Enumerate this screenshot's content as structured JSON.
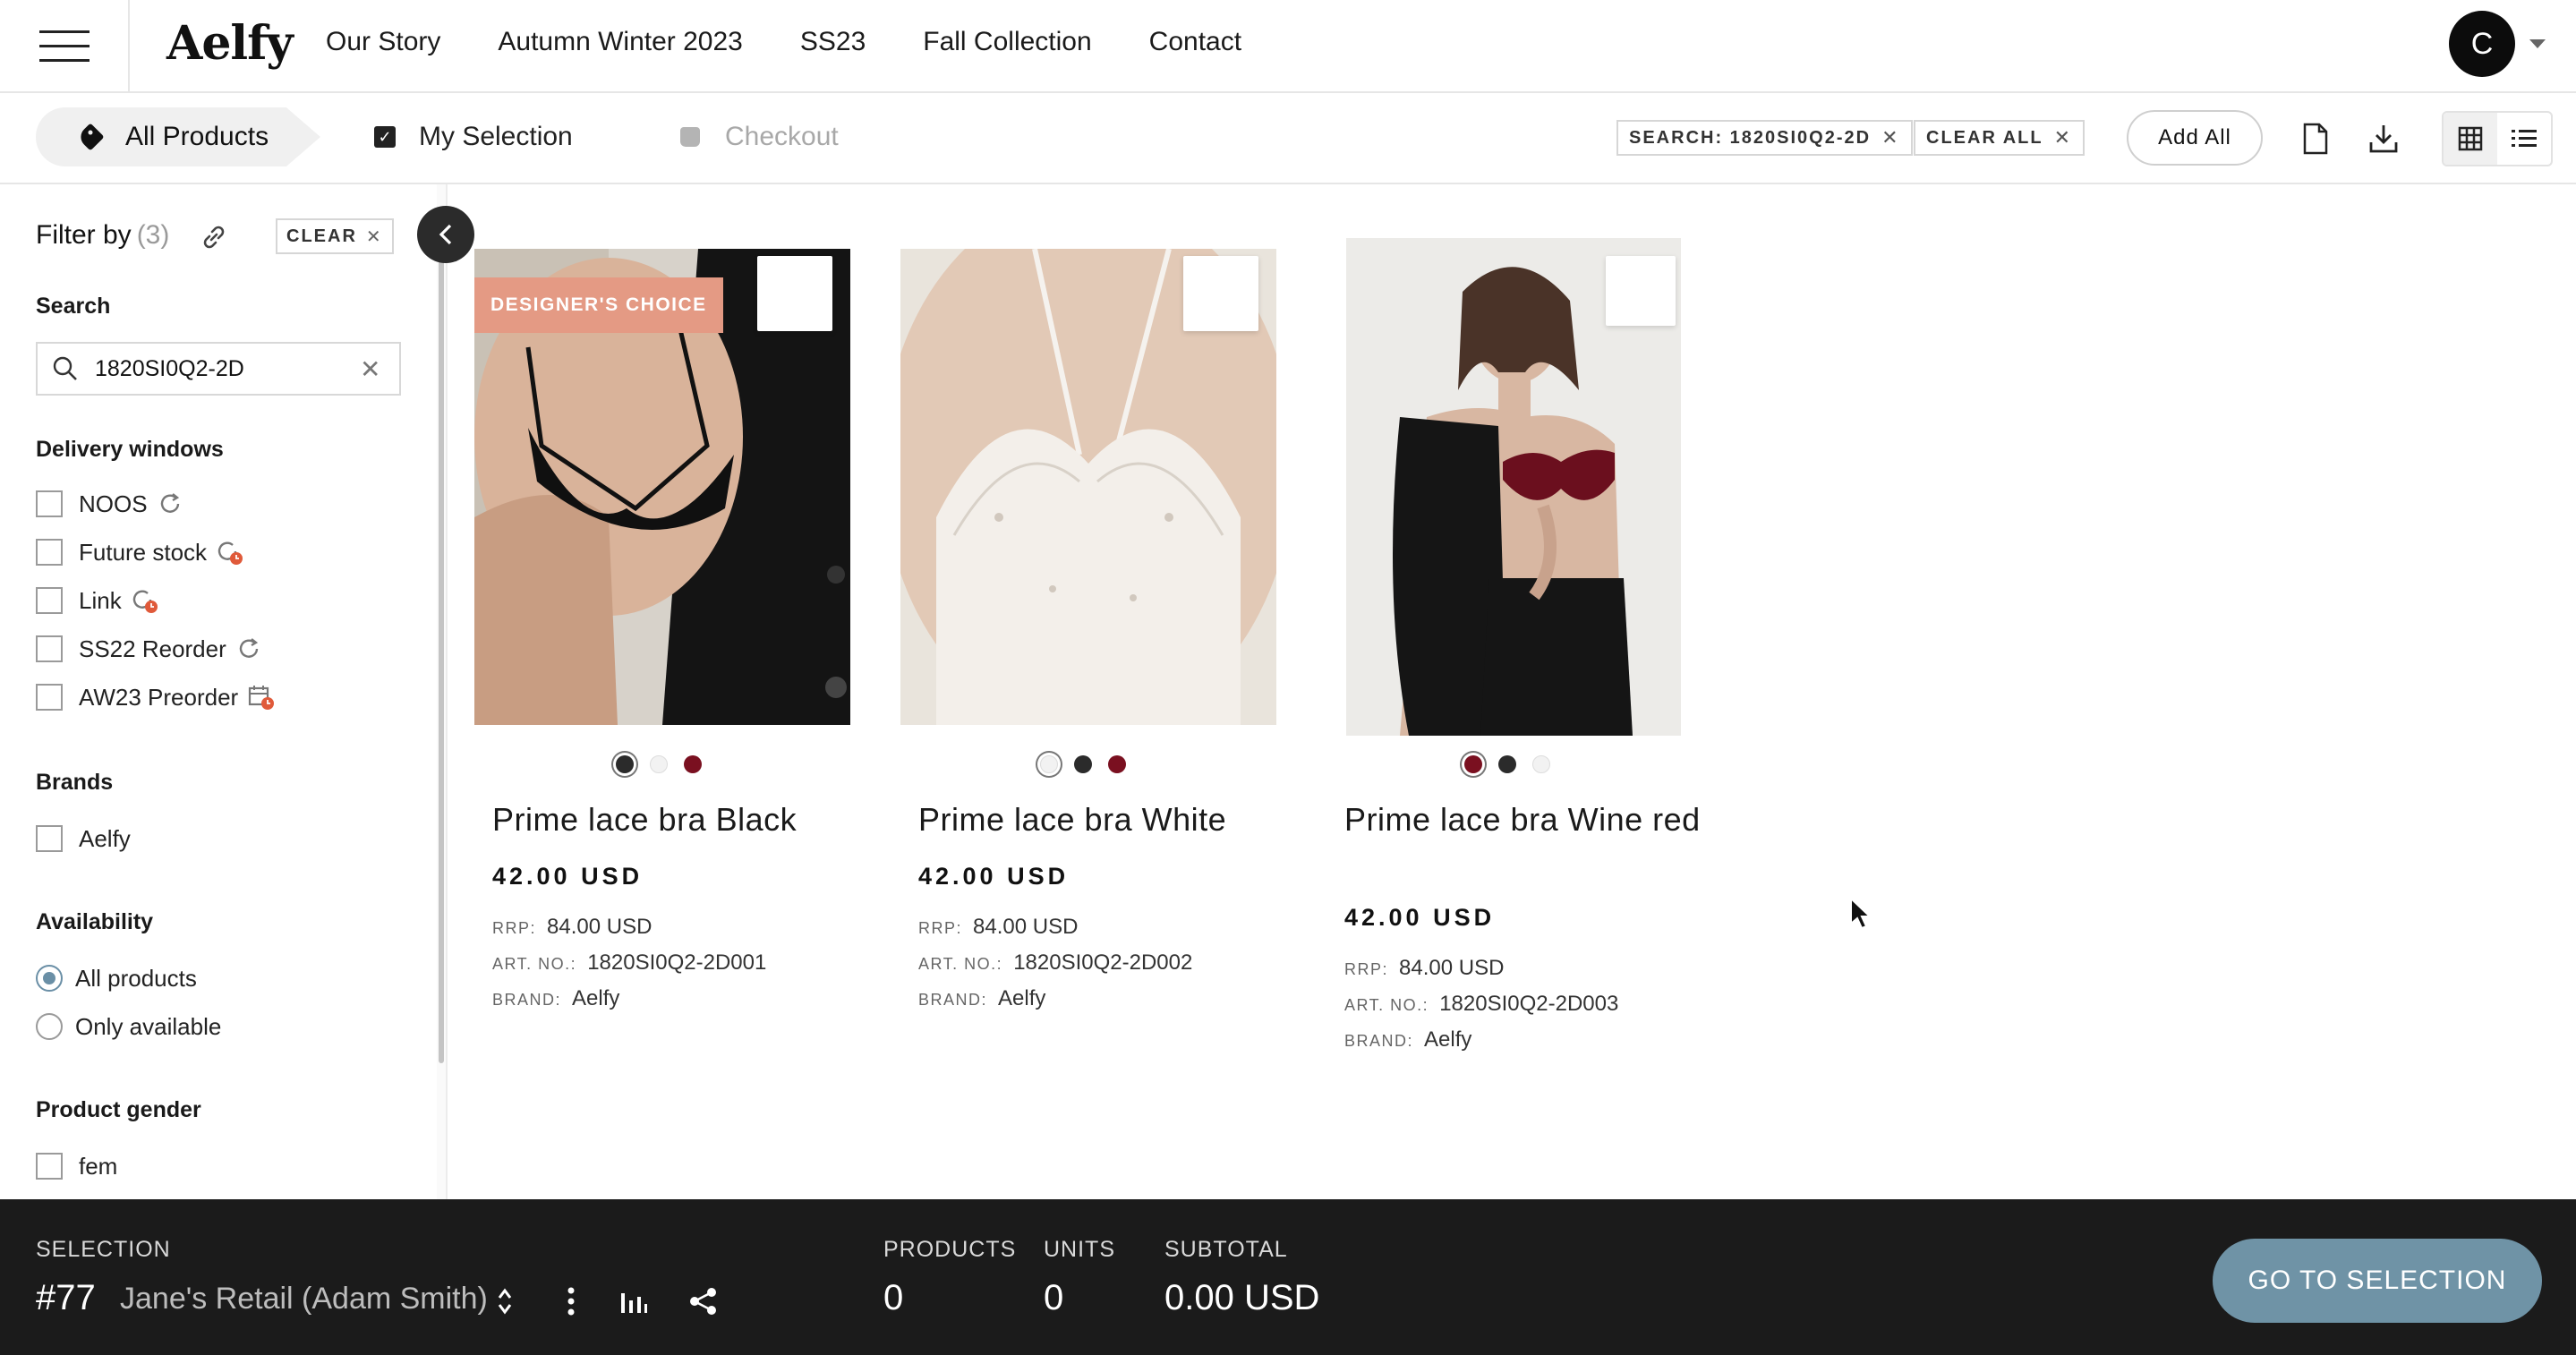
{
  "header": {
    "logo": "Aelfy",
    "nav": [
      "Our Story",
      "Autumn Winter 2023",
      "SS23",
      "Fall Collection",
      "Contact"
    ],
    "avatar_initial": "C"
  },
  "steps": {
    "all_products": "All Products",
    "my_selection": "My Selection",
    "checkout": "Checkout"
  },
  "toolbar": {
    "search_chip": "SEARCH: 1820SI0Q2-2D",
    "clear_all_chip": "CLEAR ALL",
    "add_all": "Add All"
  },
  "sidebar": {
    "filter_by": "Filter by",
    "filter_count": "(3)",
    "clear": "CLEAR",
    "search_heading": "Search",
    "search_value": "1820SI0Q2-2D",
    "delivery_heading": "Delivery windows",
    "delivery": [
      "NOOS",
      "Future stock",
      "Link",
      "SS22 Reorder",
      "AW23 Preorder"
    ],
    "brands_heading": "Brands",
    "brands": [
      "Aelfy"
    ],
    "availability_heading": "Availability",
    "availability": [
      "All products",
      "Only available"
    ],
    "availability_selected": "All products",
    "gender_heading": "Product gender",
    "gender": [
      "fem"
    ]
  },
  "products": [
    {
      "badge": "DESIGNER'S CHOICE",
      "name": "Prime lace bra Black",
      "price": "42.00 USD",
      "rrp_label": "RRP:",
      "rrp": "84.00 USD",
      "art_label": "ART. NO.:",
      "art": "1820SI0Q2-2D001",
      "brand_label": "BRAND:",
      "brand": "Aelfy",
      "swatches": [
        "#2b2b2b",
        "#f2f2f2",
        "#7a1020"
      ],
      "selected_swatch": 0
    },
    {
      "badge": "",
      "name": "Prime lace bra White",
      "price": "42.00 USD",
      "rrp_label": "RRP:",
      "rrp": "84.00 USD",
      "art_label": "ART. NO.:",
      "art": "1820SI0Q2-2D002",
      "brand_label": "BRAND:",
      "brand": "Aelfy",
      "swatches": [
        "#f2f2f2",
        "#2b2b2b",
        "#7a1020"
      ],
      "selected_swatch": 0
    },
    {
      "badge": "",
      "name": "Prime lace bra Wine red",
      "price": "42.00 USD",
      "rrp_label": "RRP:",
      "rrp": "84.00 USD",
      "art_label": "ART. NO.:",
      "art": "1820SI0Q2-2D003",
      "brand_label": "BRAND:",
      "brand": "Aelfy",
      "swatches": [
        "#7a1020",
        "#2b2b2b",
        "#f2f2f2"
      ],
      "selected_swatch": 0
    }
  ],
  "bottom": {
    "selection_label": "SELECTION",
    "selection_id": "#77",
    "selection_name": "Jane's Retail (Adam Smith)",
    "products_label": "PRODUCTS",
    "products_value": "0",
    "units_label": "UNITS",
    "units_value": "0",
    "subtotal_label": "SUBTOTAL",
    "subtotal_value": "0.00 USD",
    "go_button": "GO TO SELECTION"
  },
  "colors": {
    "accent": "#6f93a6",
    "badge": "#e49a84",
    "bottom_bar": "#1b1b1b"
  }
}
